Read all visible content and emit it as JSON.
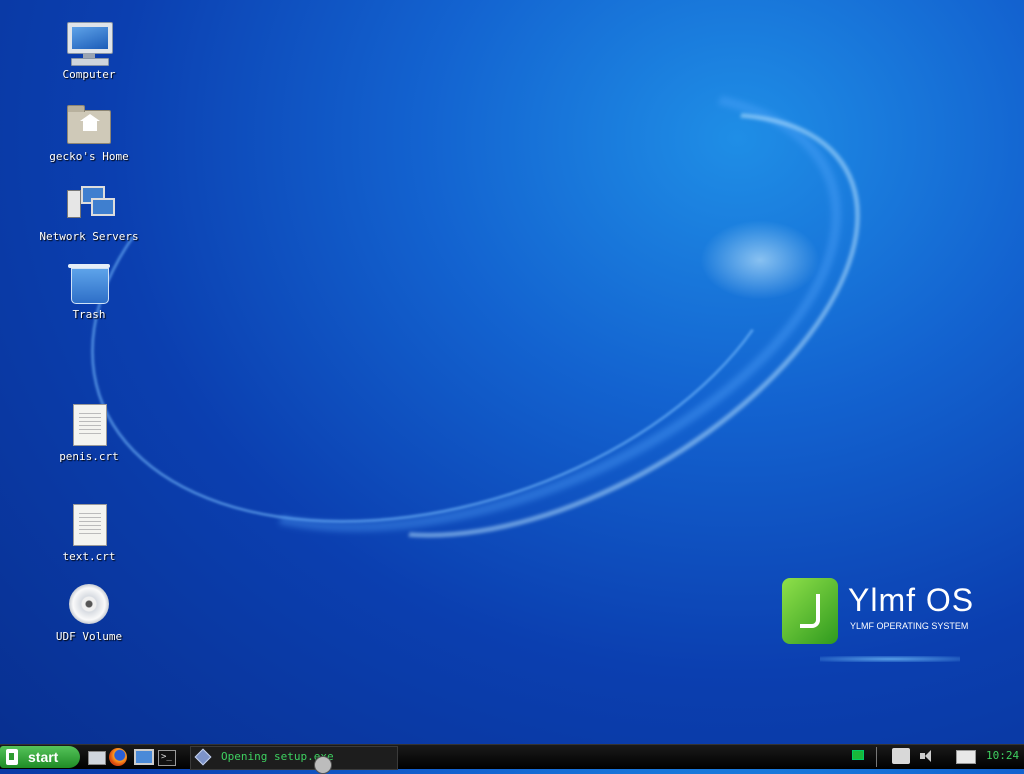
{
  "desktop": {
    "icons": [
      {
        "label": "Computer",
        "icon": "computer-icon"
      },
      {
        "label": "gecko's Home",
        "icon": "home-folder-icon"
      },
      {
        "label": "Network Servers",
        "icon": "network-servers-icon"
      },
      {
        "label": "Trash",
        "icon": "trash-icon"
      },
      {
        "label": "penis.crt",
        "icon": "document-icon"
      },
      {
        "label": "text.crt",
        "icon": "document-icon"
      },
      {
        "label": "UDF Volume",
        "icon": "cd-icon"
      }
    ],
    "logo": {
      "name": "Ylmf OS",
      "subtitle": "YLMF OPERATING SYSTEM",
      "color": "#4cc23a"
    }
  },
  "taskbar": {
    "start_label": "start",
    "quick_launch": [
      "show-desktop-icon",
      "firefox-icon",
      "computer-icon",
      "terminal-icon"
    ],
    "task": {
      "label": "Opening setup.exe",
      "icon": "setup-icon"
    },
    "tray": [
      "network-icon",
      "update-icon",
      "volume-icon",
      "mail-icon"
    ],
    "clock": "10:24",
    "accent_color": "#3ed060"
  }
}
